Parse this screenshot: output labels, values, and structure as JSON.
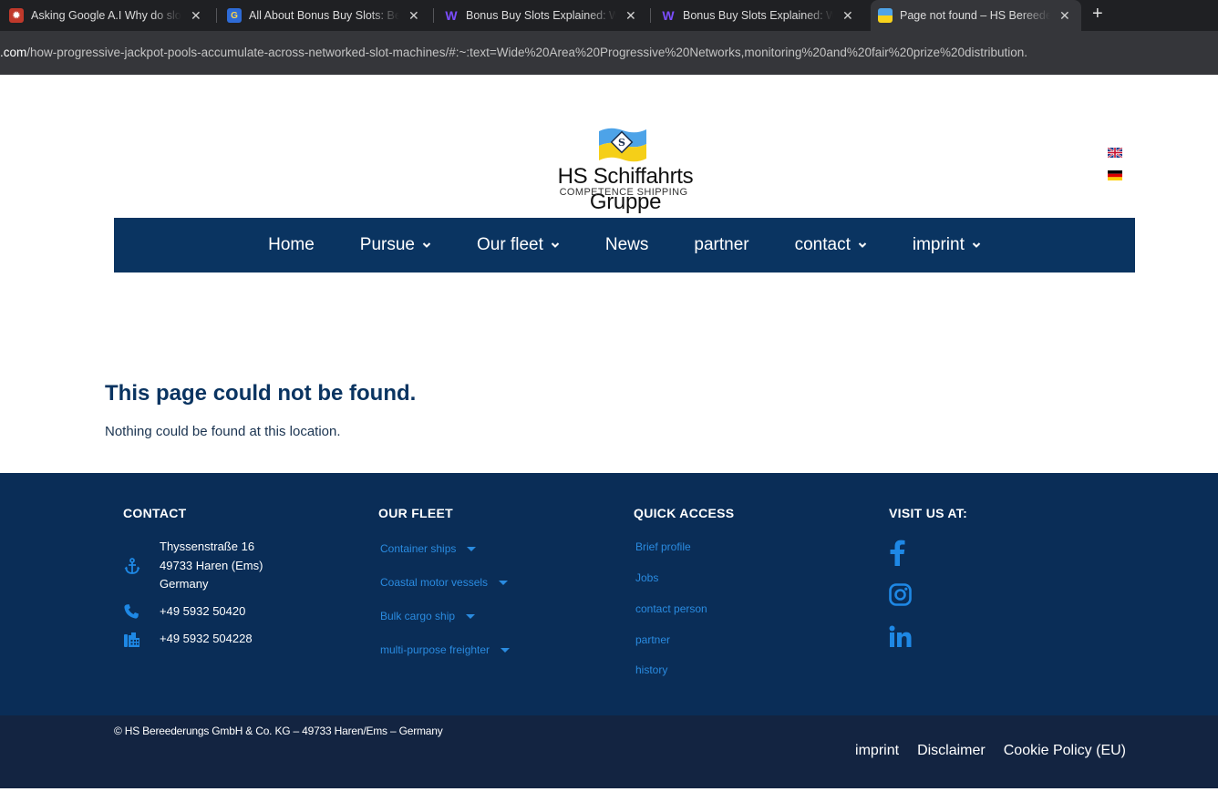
{
  "browser": {
    "tabs": [
      {
        "title": "Asking Google A.I Why do slots",
        "favicon": "bug-icon",
        "active": false
      },
      {
        "title": "All About Bonus Buy Slots: Bene",
        "favicon": "g-logo-icon",
        "active": false
      },
      {
        "title": "Bonus Buy Slots Explained: Wha",
        "favicon": "w-logo-icon",
        "active": false
      },
      {
        "title": "Bonus Buy Slots Explained: Wha",
        "favicon": "w-logo-icon",
        "active": false
      },
      {
        "title": "Page not found – HS Bereederu",
        "favicon": "flag-icon",
        "active": true
      }
    ],
    "close_glyph": "✕",
    "new_tab_glyph": "+",
    "url_host": ".com",
    "url_path": "/how-progressive-jackpot-pools-accumulate-across-networked-slot-machines/#:~:text=Wide%20Area%20Progressive%20Networks,monitoring%20and%20fair%20prize%20distribution."
  },
  "header": {
    "brand": "HS Schiffahrts Gruppe",
    "tagline": "COMPETENCE SHIPPING",
    "languages": [
      "en-flag-icon",
      "de-flag-icon"
    ]
  },
  "nav": {
    "items": [
      {
        "label": "Home",
        "dropdown": false
      },
      {
        "label": "Pursue",
        "dropdown": true
      },
      {
        "label": "Our fleet",
        "dropdown": true
      },
      {
        "label": "News",
        "dropdown": false
      },
      {
        "label": "partner",
        "dropdown": false
      },
      {
        "label": "contact",
        "dropdown": true
      },
      {
        "label": "imprint",
        "dropdown": true
      }
    ]
  },
  "main": {
    "title": "This page could not be found.",
    "text": "Nothing could be found at this location."
  },
  "footer": {
    "contact": {
      "heading": "CONTACT",
      "address_line1": "Thyssenstraße 16",
      "address_line2": "49733 Haren (Ems)",
      "address_line3": "Germany",
      "phone": "+49 5932 50420",
      "fax": "+49 5932 504228"
    },
    "fleet": {
      "heading": "OUR FLEET",
      "items": [
        "Container ships",
        "Coastal motor vessels",
        "Bulk cargo ship",
        "multi-purpose freighter"
      ]
    },
    "quick": {
      "heading": "QUICK ACCESS",
      "items": [
        "Brief profile",
        "Jobs",
        "contact person",
        "partner",
        "history"
      ]
    },
    "visit": {
      "heading": "VISIT US AT:",
      "icons": [
        "facebook-icon",
        "instagram-icon",
        "linkedin-icon"
      ]
    }
  },
  "bottom": {
    "copyright": "© HS Bereederungs GmbH & Co. KG – 49733 Haren/Ems – Germany",
    "links": [
      "imprint",
      "Disclaimer",
      "Cookie Policy (EU)"
    ]
  },
  "colors": {
    "navy": "#0a3461",
    "footer": "#0a2d57",
    "bottombar": "#132441",
    "link_blue": "#2a8be0"
  }
}
